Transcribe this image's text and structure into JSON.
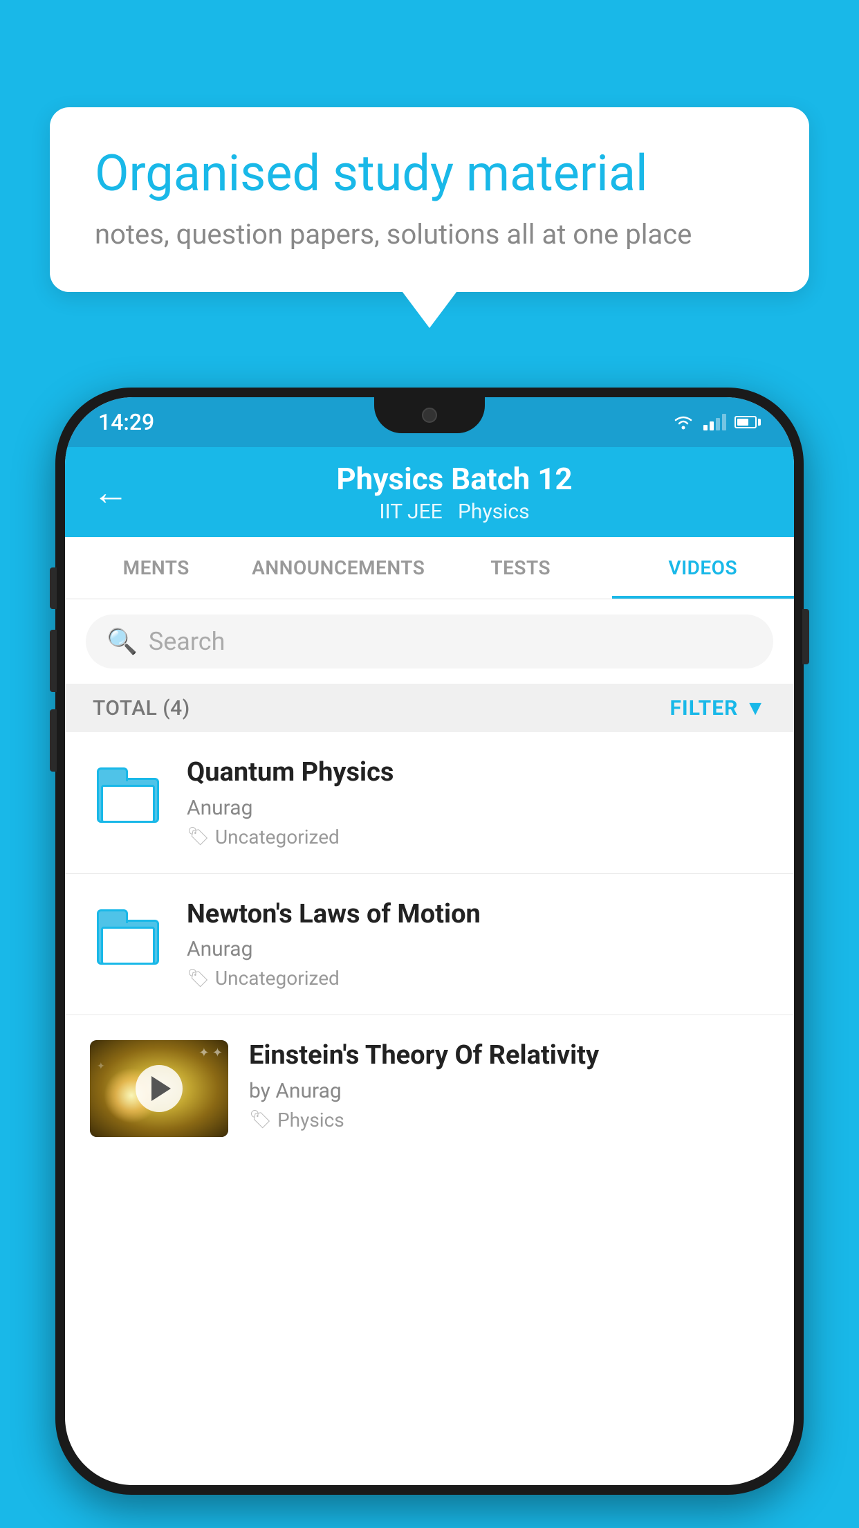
{
  "background_color": "#19b8e8",
  "speech_bubble": {
    "title": "Organised study material",
    "subtitle": "notes, question papers, solutions all at one place"
  },
  "phone": {
    "status_bar": {
      "time": "14:29",
      "wifi": true,
      "signal": true,
      "battery": true
    },
    "app_bar": {
      "title": "Physics Batch 12",
      "subtitle_parts": [
        "IIT JEE",
        "Physics"
      ],
      "back_arrow": "←"
    },
    "tabs": [
      {
        "label": "MENTS",
        "active": false
      },
      {
        "label": "ANNOUNCEMENTS",
        "active": false
      },
      {
        "label": "TESTS",
        "active": false
      },
      {
        "label": "VIDEOS",
        "active": true
      }
    ],
    "search": {
      "placeholder": "Search"
    },
    "filter_bar": {
      "total_label": "TOTAL (4)",
      "filter_label": "FILTER"
    },
    "videos": [
      {
        "title": "Quantum Physics",
        "author": "Anurag",
        "tag": "Uncategorized",
        "has_thumbnail": false
      },
      {
        "title": "Newton's Laws of Motion",
        "author": "Anurag",
        "tag": "Uncategorized",
        "has_thumbnail": false
      },
      {
        "title": "Einstein's Theory Of Relativity",
        "author": "by Anurag",
        "tag": "Physics",
        "has_thumbnail": true
      }
    ]
  }
}
